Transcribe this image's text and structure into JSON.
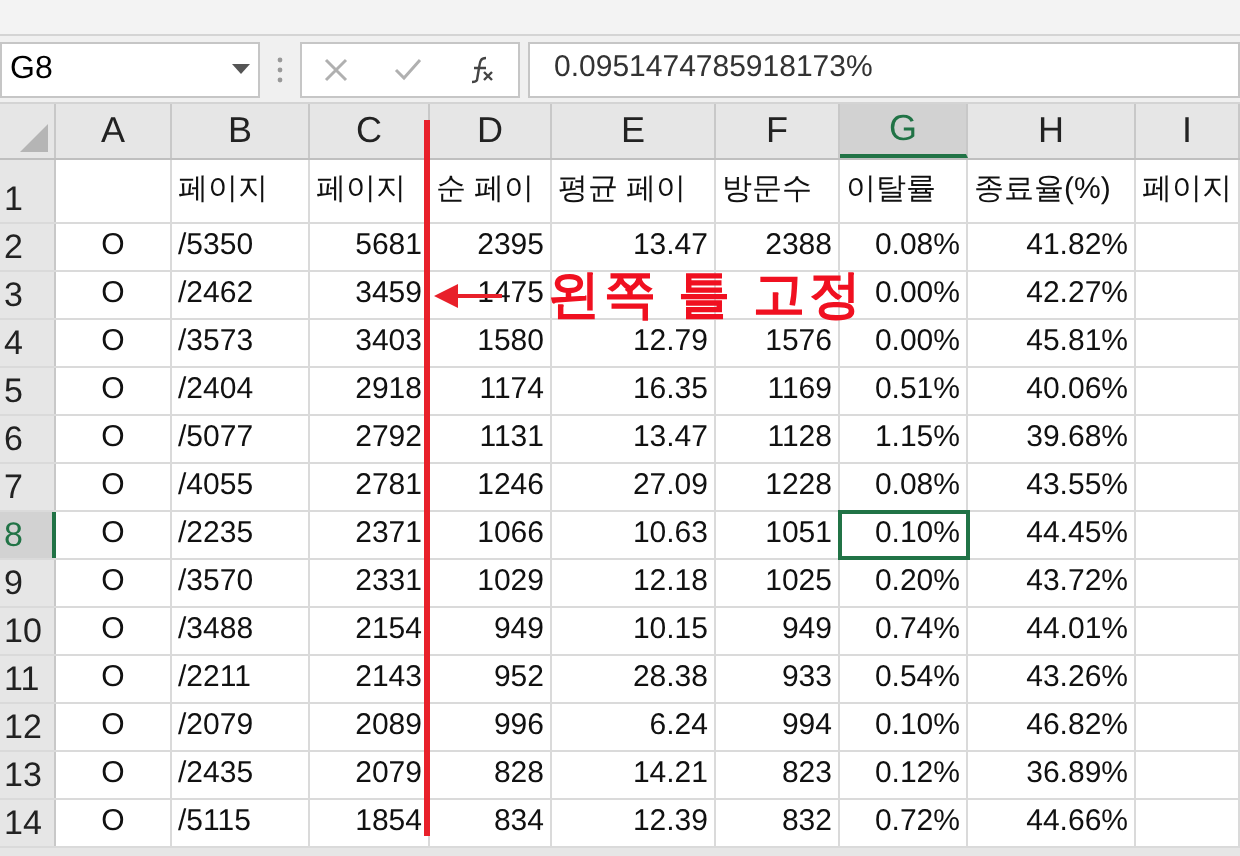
{
  "name_box": "G8",
  "formula": "0.0951474785918173%",
  "columns": [
    {
      "label": "A",
      "kind": "center",
      "selected": false
    },
    {
      "label": "B",
      "kind": "text",
      "selected": false
    },
    {
      "label": "C",
      "kind": "number",
      "selected": false
    },
    {
      "label": "D",
      "kind": "number",
      "selected": false
    },
    {
      "label": "E",
      "kind": "number",
      "selected": false
    },
    {
      "label": "F",
      "kind": "number",
      "selected": false
    },
    {
      "label": "G",
      "kind": "number",
      "selected": true
    },
    {
      "label": "H",
      "kind": "number",
      "selected": false
    },
    {
      "label": "I",
      "kind": "number",
      "selected": false
    }
  ],
  "rows": [
    {
      "header": "1",
      "selected": false,
      "kind": "heading",
      "cells": [
        null,
        "페이지",
        "페이지",
        "순 페이",
        "평균 페이",
        "방문수",
        "이탈률",
        "종료율(%)",
        "페이지"
      ]
    },
    {
      "header": "2",
      "selected": false,
      "cells": [
        "O",
        "/5350",
        "5681",
        "2395",
        "13.47",
        "2388",
        "0.08%",
        "41.82%"
      ]
    },
    {
      "header": "3",
      "selected": false,
      "cells": [
        "O",
        "/2462",
        "3459",
        "1475",
        null,
        null,
        "0.00%",
        "42.27%"
      ]
    },
    {
      "header": "4",
      "selected": false,
      "cells": [
        "O",
        "/3573",
        "3403",
        "1580",
        "12.79",
        "1576",
        "0.00%",
        "45.81%"
      ]
    },
    {
      "header": "5",
      "selected": false,
      "cells": [
        "O",
        "/2404",
        "2918",
        "1174",
        "16.35",
        "1169",
        "0.51%",
        "40.06%"
      ]
    },
    {
      "header": "6",
      "selected": false,
      "cells": [
        "O",
        "/5077",
        "2792",
        "1131",
        "13.47",
        "1128",
        "1.15%",
        "39.68%"
      ]
    },
    {
      "header": "7",
      "selected": false,
      "cells": [
        "O",
        "/4055",
        "2781",
        "1246",
        "27.09",
        "1228",
        "0.08%",
        "43.55%"
      ]
    },
    {
      "header": "8",
      "selected": true,
      "cells": [
        "O",
        "/2235",
        "2371",
        "1066",
        "10.63",
        "1051",
        "0.10%",
        "44.45%"
      ]
    },
    {
      "header": "9",
      "selected": false,
      "cells": [
        "O",
        "/3570",
        "2331",
        "1029",
        "12.18",
        "1025",
        "0.20%",
        "43.72%"
      ]
    },
    {
      "header": "10",
      "selected": false,
      "cells": [
        "O",
        "/3488",
        "2154",
        "949",
        "10.15",
        "949",
        "0.74%",
        "44.01%"
      ]
    },
    {
      "header": "11",
      "selected": false,
      "cells": [
        "O",
        "/2211",
        "2143",
        "952",
        "28.38",
        "933",
        "0.54%",
        "43.26%"
      ]
    },
    {
      "header": "12",
      "selected": false,
      "cells": [
        "O",
        "/2079",
        "2089",
        "996",
        "6.24",
        "994",
        "0.10%",
        "46.82%"
      ]
    },
    {
      "header": "13",
      "selected": false,
      "cells": [
        "O",
        "/2435",
        "2079",
        "828",
        "14.21",
        "823",
        "0.12%",
        "36.89%"
      ]
    },
    {
      "header": "14",
      "selected": false,
      "cells": [
        "O",
        "/5115",
        "1854",
        "834",
        "12.39",
        "832",
        "0.72%",
        "44.66%"
      ]
    }
  ],
  "annotation": {
    "text": "왼쪽 틀 고정"
  }
}
